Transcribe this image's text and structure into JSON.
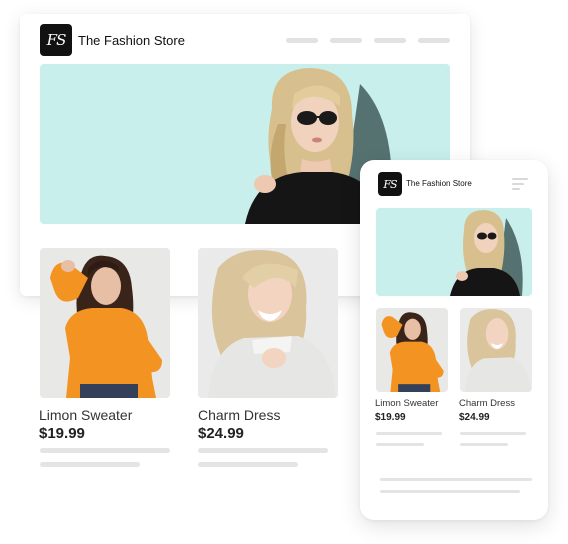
{
  "brand": {
    "logo_text": "FS",
    "name": "The Fashion Store"
  },
  "products": [
    {
      "name": "Limon Sweater",
      "price": "$19.99"
    },
    {
      "name": "Charm Dress",
      "price": "$24.99"
    }
  ],
  "colors": {
    "hero_bg": "#c9efed",
    "sweater_orange": "#f39322",
    "logo_bg": "#111111"
  },
  "icons": {
    "menu": "hamburger-menu-icon",
    "logo": "brand-logo-icon"
  }
}
